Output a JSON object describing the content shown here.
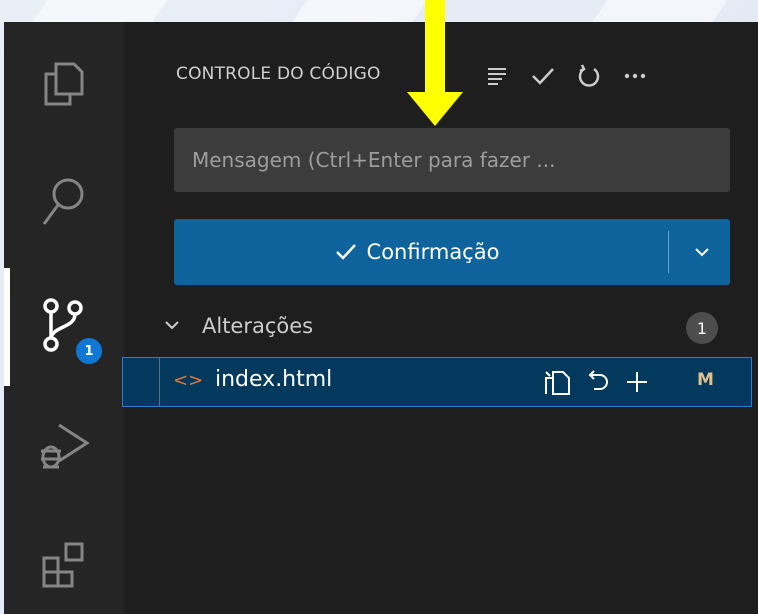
{
  "source_control": {
    "title": "CONTROLE DO CÓDIGO",
    "message_placeholder": "Mensagem (Ctrl+Enter para fazer ...",
    "commit_label": "Confirmação",
    "sections": [
      {
        "label": "Alterações",
        "count": "1",
        "files": [
          {
            "name": "index.html",
            "status": "M",
            "icon": "html-code-icon"
          }
        ]
      }
    ]
  },
  "activity_bar": {
    "items": [
      {
        "name": "explorer",
        "icon": "files-icon"
      },
      {
        "name": "search",
        "icon": "search-icon"
      },
      {
        "name": "source-control",
        "icon": "source-control-icon",
        "badge": "1"
      },
      {
        "name": "run-debug",
        "icon": "run-debug-icon"
      },
      {
        "name": "extensions",
        "icon": "extensions-icon"
      }
    ]
  },
  "colors": {
    "accent": "#0e639c",
    "selection": "#04395e",
    "badge": "#0e78d4",
    "modified": "#e2c08d",
    "annotation_arrow": "#ffff00"
  }
}
